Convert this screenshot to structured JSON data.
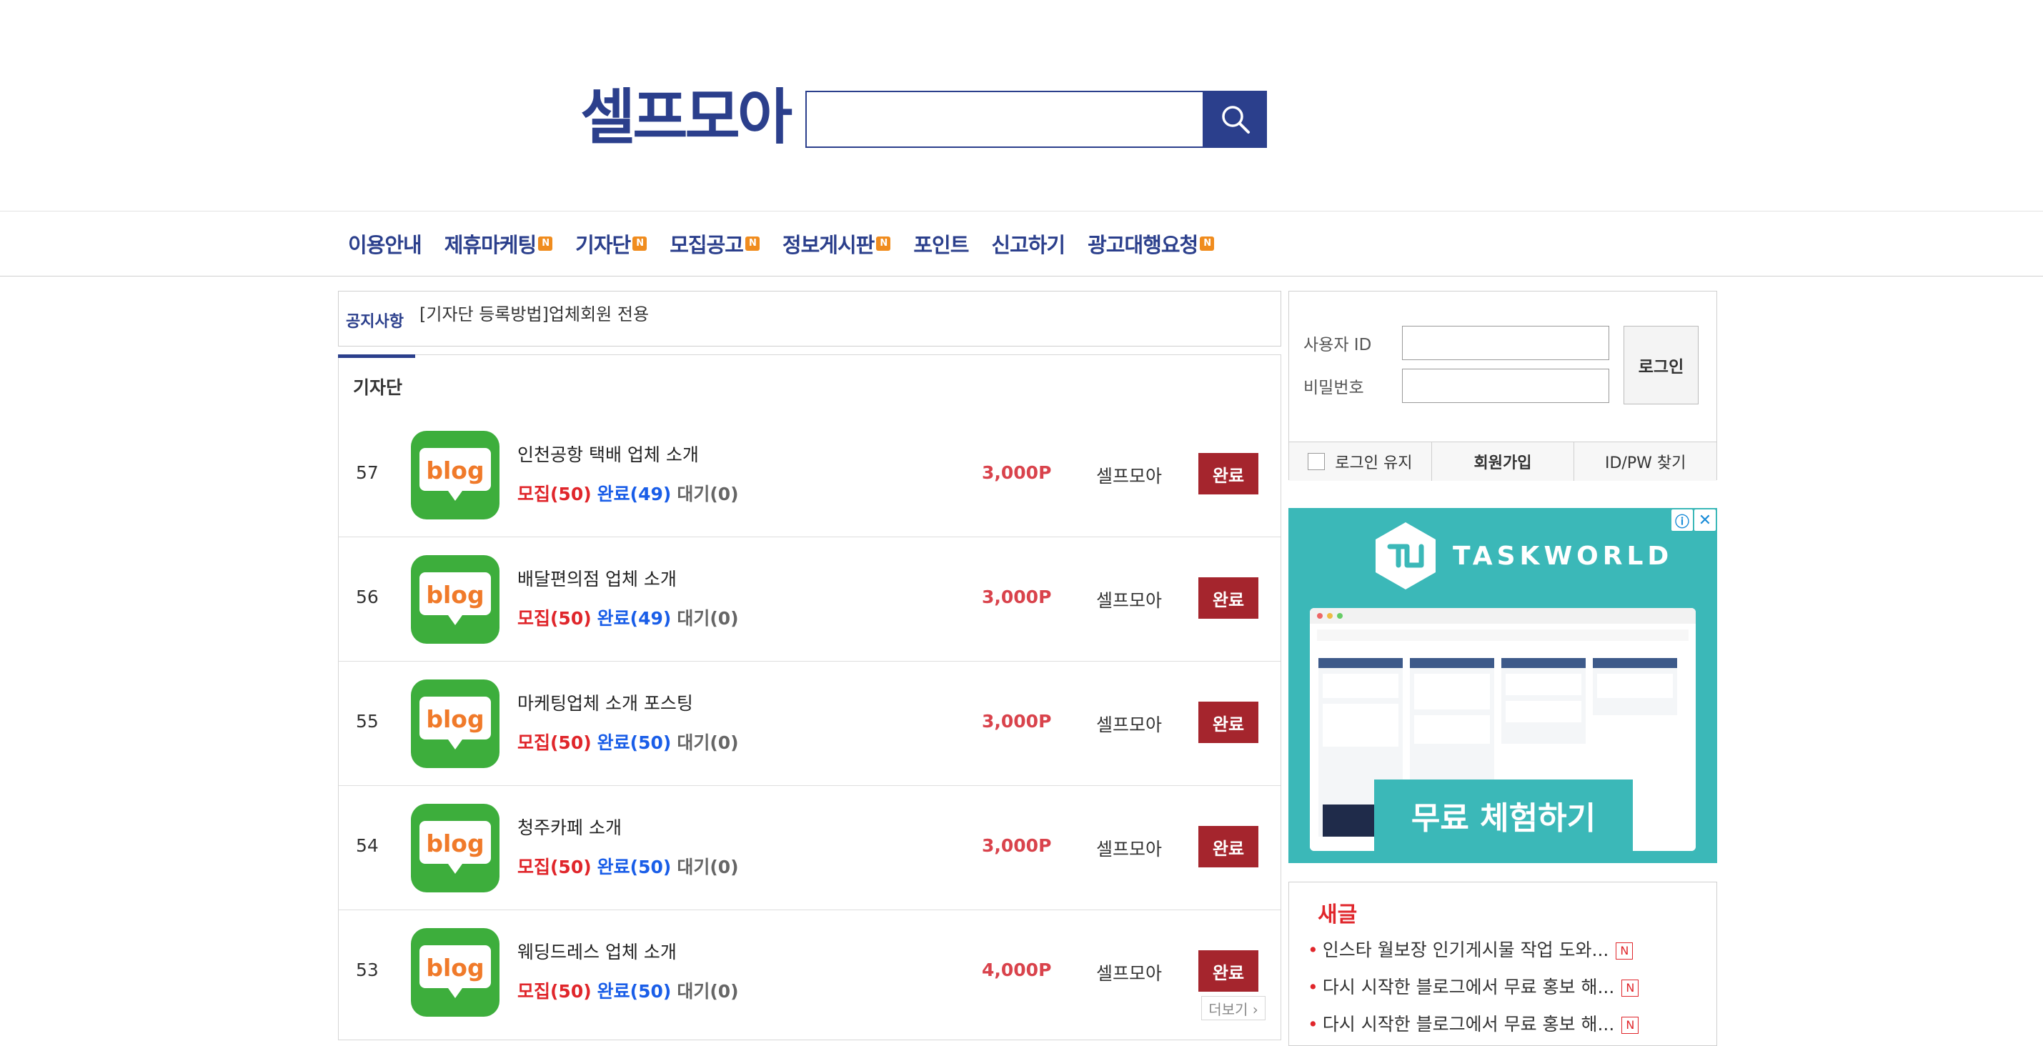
{
  "header": {
    "logo": "셀프모아",
    "search": {
      "value": "",
      "placeholder": ""
    }
  },
  "nav": [
    {
      "label": "이용안내",
      "badge": ""
    },
    {
      "label": "제휴마케팅",
      "badge": "N"
    },
    {
      "label": "기자단",
      "badge": "N"
    },
    {
      "label": "모집공고",
      "badge": "N"
    },
    {
      "label": "정보게시판",
      "badge": "N"
    },
    {
      "label": "포인트",
      "badge": ""
    },
    {
      "label": "신고하기",
      "badge": ""
    },
    {
      "label": "광고대행요청",
      "badge": "N"
    }
  ],
  "notice": {
    "label": "공지사항",
    "text": "[기자단 등록방법]업체회원 전용"
  },
  "list": {
    "title": "기자단",
    "icon_text": "blog",
    "rows": [
      {
        "num": "57",
        "title": "인천공항 택배 업체 소개",
        "recruit": "모집(50)",
        "done": "완료(49)",
        "wait": "대기(0)",
        "points": "3,000P",
        "author": "셀프모아",
        "status": "완료"
      },
      {
        "num": "56",
        "title": "배달편의점 업체 소개",
        "recruit": "모집(50)",
        "done": "완료(49)",
        "wait": "대기(0)",
        "points": "3,000P",
        "author": "셀프모아",
        "status": "완료"
      },
      {
        "num": "55",
        "title": "마케팅업체 소개 포스팅",
        "recruit": "모집(50)",
        "done": "완료(50)",
        "wait": "대기(0)",
        "points": "3,000P",
        "author": "셀프모아",
        "status": "완료"
      },
      {
        "num": "54",
        "title": "청주카페 소개",
        "recruit": "모집(50)",
        "done": "완료(50)",
        "wait": "대기(0)",
        "points": "3,000P",
        "author": "셀프모아",
        "status": "완료"
      },
      {
        "num": "53",
        "title": "웨딩드레스 업체 소개",
        "recruit": "모집(50)",
        "done": "완료(50)",
        "wait": "대기(0)",
        "points": "4,000P",
        "author": "셀프모아",
        "status": "완료"
      }
    ],
    "more": "더보기 ›"
  },
  "login": {
    "id_label": "사용자 ID",
    "pw_label": "비밀번호",
    "login_button": "로그인",
    "keep_login": "로그인 유지",
    "signup": "회원가입",
    "find": "ID/PW 찾기"
  },
  "ad": {
    "brand": "TASKWORLD",
    "cta": "무료 체험하기",
    "info": "ⓘ",
    "close": "✕"
  },
  "new_posts": {
    "title": "새글",
    "badge": "N",
    "items": [
      "인스타 월보장 인기게시물 작업 도와...",
      "다시 시작한 블로그에서 무료 홍보 해...",
      "다시 시작한 블로그에서 무료 홍보 해..."
    ]
  },
  "colors": {
    "brand": "#2b3f8c",
    "badge": "#f08c1e",
    "status_button": "#a5252d",
    "recruit": "#e0262b",
    "done": "#1a5ee8",
    "points": "#d9434c",
    "blog_green": "#3dae3c",
    "blog_orange": "#f07a2a",
    "ad_teal": "#3bb8b8"
  },
  "icons": [
    "search-icon",
    "blog-icon",
    "ad-info-icon",
    "ad-close-icon"
  ]
}
